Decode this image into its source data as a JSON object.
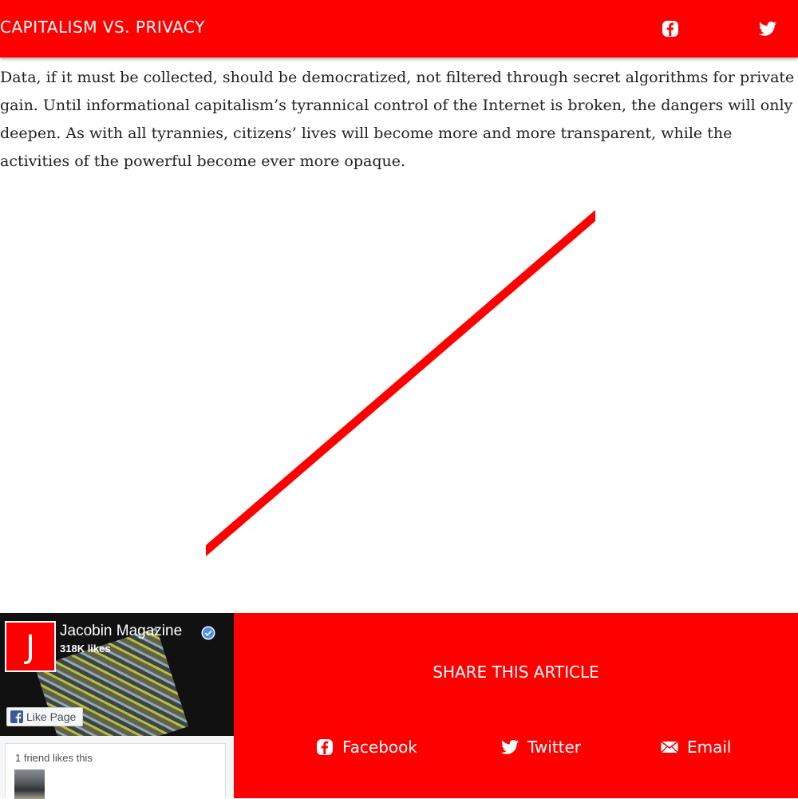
{
  "topbar": {
    "title": "CAPITALISM VS. PRIVACY",
    "facebook_icon": "facebook-icon",
    "twitter_icon": "twitter-icon",
    "background": "#ff0000"
  },
  "article": {
    "paragraph": "Data, if it must be collected, should be democratized, not filtered through secret algorithms for private gain. Until informational capitalism’s tyrannical control of the Internet is broken, the dangers will only deepen. As with all tyrannies, citizens’ lives will become more and more transparent, while the activities of the powerful become ever more opaque."
  },
  "facebook_widget": {
    "page_name": "Jacobin Magazine",
    "logo_letter": "J",
    "likes": "318K likes",
    "like_button": "Like Page",
    "friends_text": "1 friend likes this"
  },
  "share": {
    "title": "SHARE THIS ARTICLE",
    "facebook": "Facebook",
    "twitter": "Twitter",
    "email": "Email"
  },
  "colors": {
    "accent": "#ff0000",
    "facebook_blue": "#3b5998"
  }
}
